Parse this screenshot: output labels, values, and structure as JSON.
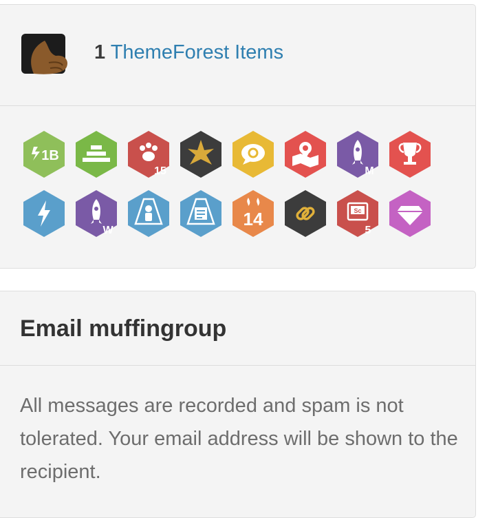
{
  "author": {
    "items_count": "1",
    "items_link": "ThemeForest Items"
  },
  "badges": [
    {
      "name": "one-billion-badge",
      "color": "#8fbf5a",
      "label": "1B"
    },
    {
      "name": "level-badge",
      "color": "#7ab847",
      "label": ""
    },
    {
      "name": "paw-badge",
      "color": "#c9504c",
      "label": "15"
    },
    {
      "name": "star-badge",
      "color": "#3c3c3c",
      "label": ""
    },
    {
      "name": "feedback-badge",
      "color": "#e8b935",
      "label": ""
    },
    {
      "name": "map-badge",
      "color": "#e3524f",
      "label": ""
    },
    {
      "name": "rocket-m-badge",
      "color": "#7a5aa6",
      "label": "M"
    },
    {
      "name": "trophy-badge",
      "color": "#e3524f",
      "label": ""
    },
    {
      "name": "lightning-badge",
      "color": "#5a9fcb",
      "label": ""
    },
    {
      "name": "rocket-w-badge",
      "color": "#7a5aa6",
      "label": "W"
    },
    {
      "name": "spotlight-person-badge",
      "color": "#5a9fcb",
      "label": ""
    },
    {
      "name": "spotlight-doc-badge",
      "color": "#5a9fcb",
      "label": ""
    },
    {
      "name": "years-badge",
      "color": "#e8884a",
      "label": "14"
    },
    {
      "name": "link-badge",
      "color": "#3c3c3c",
      "label": ""
    },
    {
      "name": "sc-badge",
      "color": "#c9504c",
      "label": "5"
    },
    {
      "name": "diamond-badge",
      "color": "#c462c3",
      "label": ""
    }
  ],
  "email": {
    "title": "Email muffingroup",
    "note": "All messages are recorded and spam is not tolerated. Your email address will be shown to the recipient."
  }
}
